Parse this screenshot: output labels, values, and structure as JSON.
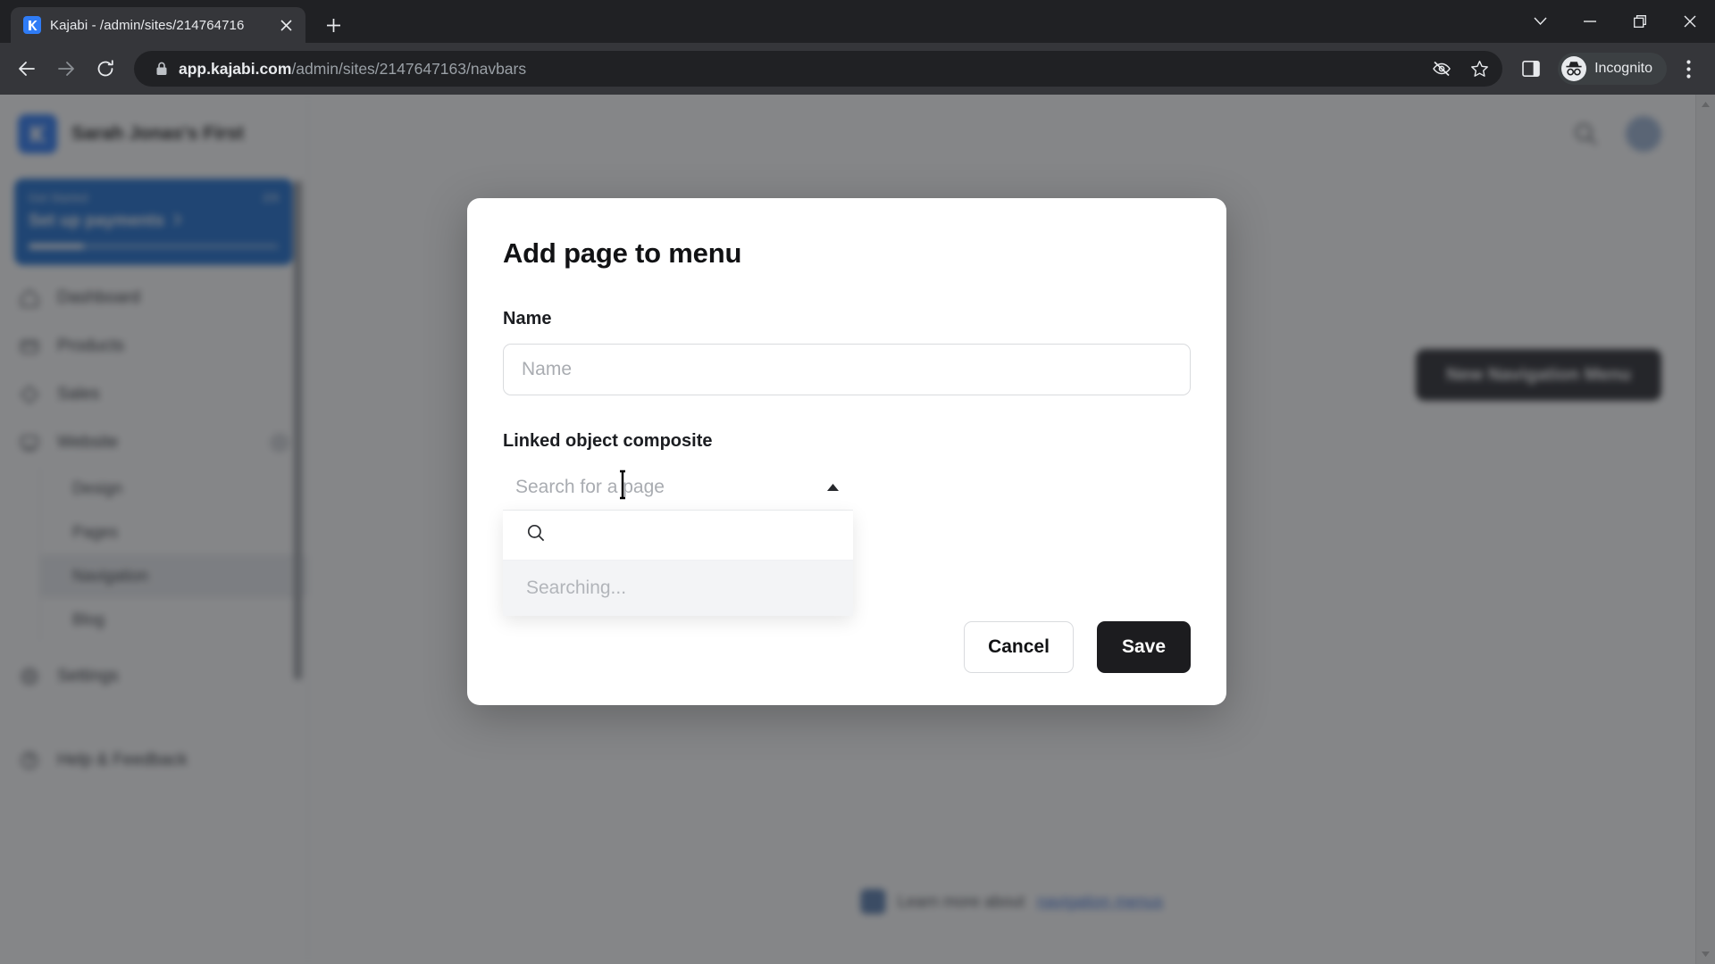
{
  "browser": {
    "tab": {
      "title": "Kajabi - /admin/sites/214764716",
      "favicon_name": "kajabi-favicon",
      "close_label": "✕"
    },
    "new_tab_label": "+",
    "window_controls": [
      {
        "name": "tab-search-button",
        "glyph": "⌄"
      },
      {
        "name": "minimize-button",
        "glyph": "—"
      },
      {
        "name": "maximize-button",
        "glyph": "❐"
      },
      {
        "name": "close-window-button",
        "glyph": "✕"
      }
    ],
    "toolbar": {
      "back_label": "←",
      "forward_label": "→",
      "reload_label": "⟳",
      "url_domain": "app.kajabi.com",
      "url_path": "/admin/sites/2147647163/navbars",
      "url_full": "app.kajabi.com/admin/sites/2147647163/navbars",
      "incognito_label": "Incognito",
      "menu_label": "⋮"
    }
  },
  "app": {
    "brand_name": "Sarah Jonas's First",
    "setup_card": {
      "kicker": "Get Started",
      "count": "2/9",
      "title": "Set up payments",
      "progress_percent": 22
    },
    "nav": [
      {
        "label": "Dashboard",
        "icon": "home-icon"
      },
      {
        "label": "Products",
        "icon": "products-icon"
      },
      {
        "label": "Sales",
        "icon": "sales-icon"
      },
      {
        "label": "Website",
        "icon": "website-icon",
        "has_badge": true
      }
    ],
    "nav_sub": [
      {
        "label": "Design",
        "active": false
      },
      {
        "label": "Pages",
        "active": false
      },
      {
        "label": "Navigation",
        "active": true
      },
      {
        "label": "Blog",
        "active": false
      }
    ],
    "nav_bottom": [
      {
        "label": "Settings",
        "icon": "gear-icon"
      },
      {
        "label": "Help & Feedback",
        "icon": "help-icon"
      }
    ],
    "main": {
      "new_menu_button": "New Navigation Menu",
      "empty_hint": "—",
      "learn_more_prefix": "Learn more about",
      "learn_more_link": "navigation menus"
    }
  },
  "modal": {
    "title": "Add page to menu",
    "name_label": "Name",
    "name_value": "",
    "name_placeholder": "Name",
    "composite_label": "Linked object composite",
    "combo_placeholder": "Search for a page",
    "combo_toggle_icon": "chevron-up-icon",
    "search_icon": "search-icon",
    "search_value": "",
    "status_text": "Searching...",
    "cancel_label": "Cancel",
    "save_label": "Save"
  },
  "colors": {
    "brand_blue": "#2f7cf6",
    "setup_blue": "#1f6fd0",
    "save_dark": "#1c1c1f",
    "chrome_dark": "#202124",
    "toolbar_dark": "#35363a",
    "overlay": "rgba(33,35,38,0.55)"
  }
}
